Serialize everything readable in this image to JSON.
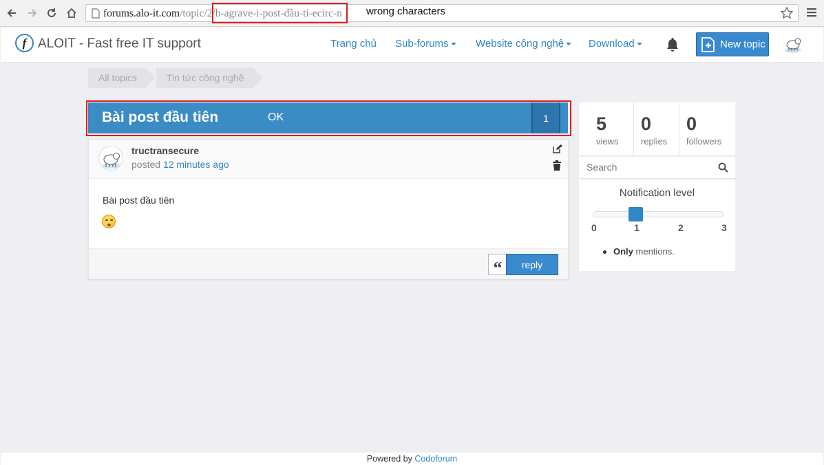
{
  "browser": {
    "url_host": "forums.alo-it.com",
    "url_path_start": "/topic/2/",
    "url_path_highlighted": "b-agrave-i-post-đầu-ti-ecirc-n",
    "annotation": "wrong characters"
  },
  "header": {
    "logo_letter": "f",
    "brand": "ALOIT - Fast free IT support",
    "nav": [
      {
        "label": "Trang chủ"
      },
      {
        "label": "Sub-forums"
      },
      {
        "label": "Website công nghệ"
      },
      {
        "label": "Download"
      }
    ],
    "new_topic_label": "New topic"
  },
  "breadcrumb": {
    "items": [
      {
        "label": "All topics"
      },
      {
        "label": "Tin tức công nghệ"
      }
    ]
  },
  "topic": {
    "title": "Bài post đầu tiên",
    "ok_label": "OK",
    "post_count": "1"
  },
  "post": {
    "author": "tructransecure",
    "posted_label": "posted",
    "time": "12 minutes ago",
    "body": "Bài post đầu tiên",
    "reply_label": "reply",
    "quote_glyph": "“"
  },
  "stats": {
    "views": {
      "value": "5",
      "label": "views"
    },
    "replies": {
      "value": "0",
      "label": "replies"
    },
    "followers": {
      "value": "0",
      "label": "followers"
    }
  },
  "search": {
    "placeholder": "Search"
  },
  "notification": {
    "title": "Notification level",
    "ticks": [
      "0",
      "1",
      "2",
      "3"
    ],
    "level": 1,
    "desc_bold": "Only",
    "desc_rest": "mentions."
  },
  "footer": {
    "prefix": "Powered by",
    "link": "Codoforum"
  },
  "colors": {
    "accent": "#3b8bc4",
    "link": "#2f87c8",
    "highlight": "#e01b1b"
  }
}
